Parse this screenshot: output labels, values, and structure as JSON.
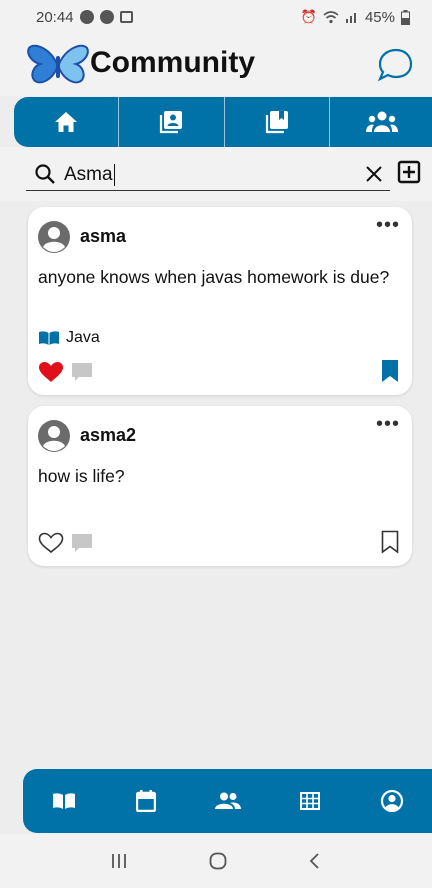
{
  "status": {
    "time": "20:44",
    "battery": "45%",
    "left_icons": [
      "messenger-icon",
      "notification-icon",
      "image-icon"
    ],
    "right_icons": [
      "alarm-icon",
      "wifi-icon",
      "signal-icon",
      "battery-icon"
    ]
  },
  "app": {
    "title": "Community",
    "accent": "#0072a8",
    "logo_colors": [
      "#2f7fd6",
      "#1e4fa8",
      "#7ec2ef"
    ]
  },
  "top_tabs": [
    {
      "icon": "home-icon",
      "active": true
    },
    {
      "icon": "contact-book-icon",
      "active": false
    },
    {
      "icon": "bookmark-collection-icon",
      "active": false
    },
    {
      "icon": "groups-icon",
      "active": false
    }
  ],
  "search": {
    "value": "Asma",
    "icon": "search-icon",
    "clear_icon": "close-icon",
    "add_icon": "add-box-icon"
  },
  "posts": [
    {
      "username": "asma",
      "text": "anyone knows when javas homework is due?",
      "tag": "Java",
      "liked": true,
      "bookmarked": true
    },
    {
      "username": "asma2",
      "text": "how is life?",
      "tag": "",
      "liked": false,
      "bookmarked": false
    }
  ],
  "colors": {
    "like": "#e0101a",
    "comment": "#c7c7c7",
    "bookmark": "#0072a8"
  },
  "bottom_nav": [
    {
      "icon": "book-icon"
    },
    {
      "icon": "calendar-icon"
    },
    {
      "icon": "people-icon"
    },
    {
      "icon": "table-icon"
    },
    {
      "icon": "account-circle-icon"
    }
  ],
  "system_nav": [
    "recents-icon",
    "home-circle-icon",
    "back-icon"
  ]
}
